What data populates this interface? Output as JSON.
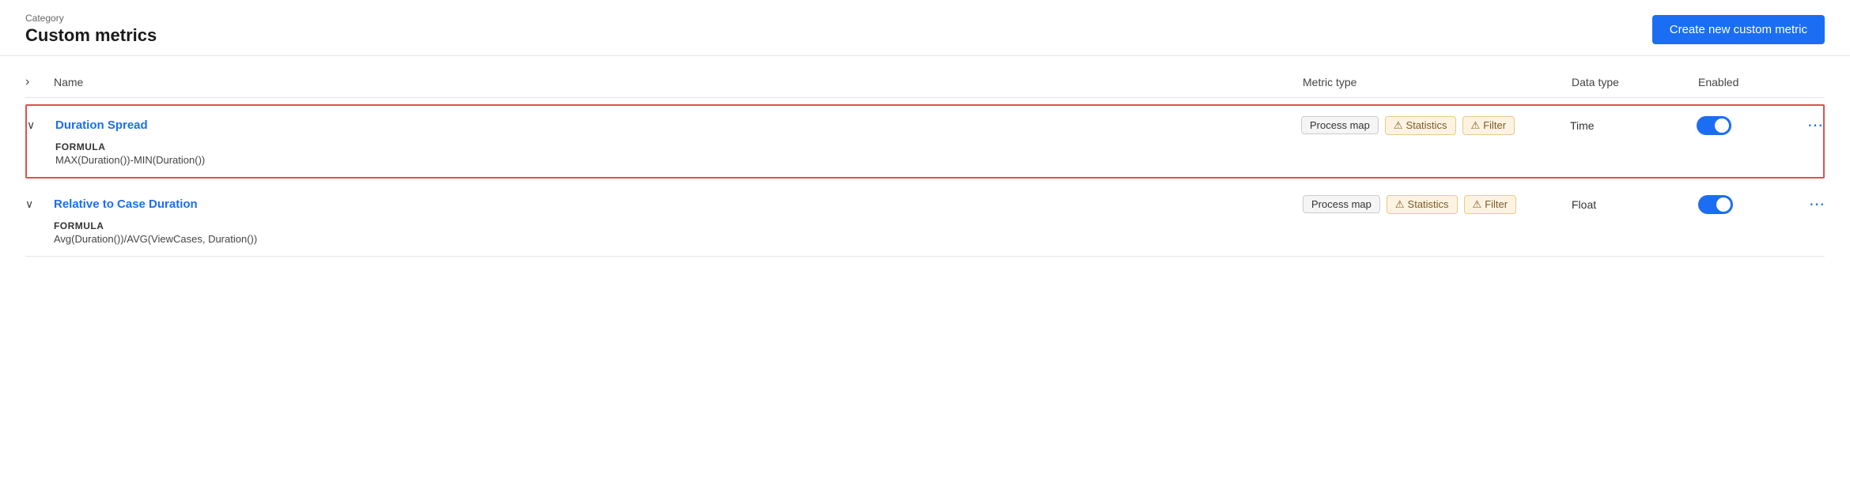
{
  "header": {
    "category_label": "Category",
    "page_title": "Custom metrics",
    "create_button_label": "Create new custom metric"
  },
  "table": {
    "columns": {
      "expand": "",
      "name": "Name",
      "metric_type": "Metric type",
      "data_type": "Data type",
      "enabled": "Enabled"
    },
    "rows": [
      {
        "id": "duration-spread",
        "name": "Duration Spread",
        "expanded": true,
        "highlighted": true,
        "formula_label": "FORMULA",
        "formula_text": "MAX(Duration())-MIN(Duration())",
        "metric_tags": [
          {
            "type": "normal",
            "label": "Process map"
          },
          {
            "type": "warning",
            "label": "Statistics"
          },
          {
            "type": "warning",
            "label": "Filter"
          }
        ],
        "data_type": "Time",
        "enabled": true
      },
      {
        "id": "relative-to-case-duration",
        "name": "Relative to Case Duration",
        "expanded": true,
        "highlighted": false,
        "formula_label": "FORMULA",
        "formula_text": "Avg(Duration())/AVG(ViewCases, Duration())",
        "metric_tags": [
          {
            "type": "normal",
            "label": "Process map"
          },
          {
            "type": "warning",
            "label": "Statistics"
          },
          {
            "type": "warning",
            "label": "Filter"
          }
        ],
        "data_type": "Float",
        "enabled": true
      }
    ]
  },
  "icons": {
    "chevron_right": "›",
    "chevron_down": "∨",
    "warning": "⚠",
    "ellipsis": "⋯"
  }
}
